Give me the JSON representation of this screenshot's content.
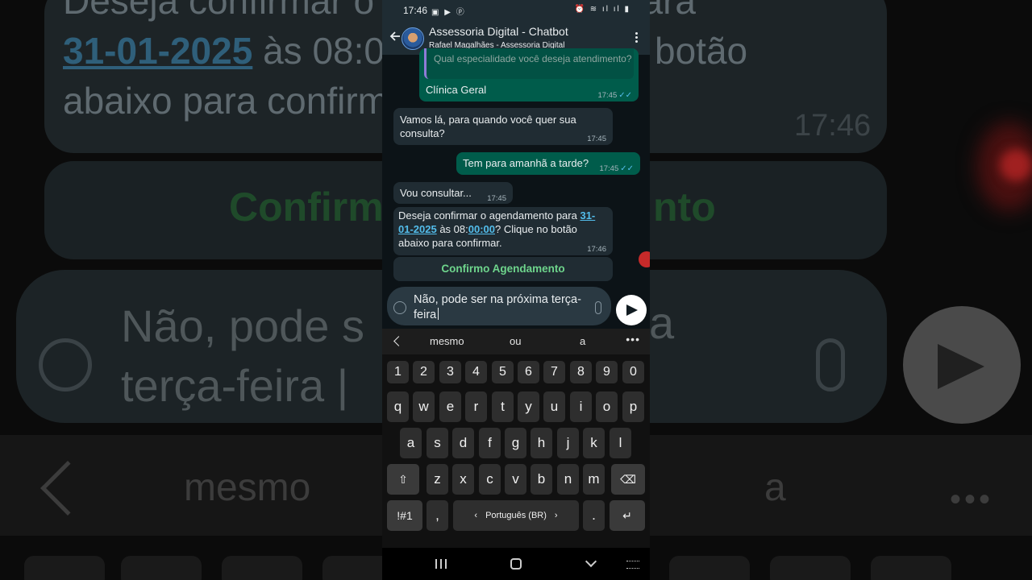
{
  "background": {
    "top_text_line1": "Deseja confirmar o agendamento para",
    "top_text_date": "31-01-2025",
    "top_text_line2_rest": " às 08:00:00? Clique no botão",
    "top_text_line3": "abaixo para confirmar.",
    "top_time": "17:46",
    "button_left": "Confirm",
    "button_right": "nto",
    "input_line1": "Não, pode s",
    "input_line1_right": "a",
    "input_line2": "terça-feira |",
    "kb_word_1": "mesmo",
    "kb_word_2": "a",
    "kb_dots": "•••"
  },
  "status_bar": {
    "time": "17:46",
    "left_icons": "▣ ▶ ⓟ",
    "right_icons": "⏰ ≋ ıl ıl ▮"
  },
  "header": {
    "title": "Assessoria Digital - Chatbot",
    "subtitle": "Rafael Magalhães - Assessoria Digital"
  },
  "messages": {
    "m1": {
      "quote": "Qual especialidade você deseja atendimento?",
      "text": "Clínica Geral",
      "time": "17:45",
      "ticks": "✓✓"
    },
    "m2": {
      "text": "Vamos lá, para quando você quer sua consulta?",
      "time": "17:45"
    },
    "m3": {
      "text": "Tem para amanhã a tarde?",
      "time": "17:45",
      "ticks": "✓✓"
    },
    "m4": {
      "text": "Vou consultar...",
      "time": "17:45"
    },
    "m5": {
      "pre": "Deseja confirmar o agendamento para ",
      "date": "31-01-2025",
      "mid": " às 08:",
      "time_link": "00:00",
      "post": "? Clique no botão abaixo para confirmar.",
      "time": "17:46"
    },
    "confirm_button": "Confirmo Agendamento"
  },
  "composer": {
    "text": "Não, pode ser na próxima terça-feira"
  },
  "keyboard": {
    "suggestions": [
      "mesmo",
      "ou",
      "a"
    ],
    "more": "•••",
    "row_num": [
      "1",
      "2",
      "3",
      "4",
      "5",
      "6",
      "7",
      "8",
      "9",
      "0"
    ],
    "row_1": [
      "q",
      "w",
      "e",
      "r",
      "t",
      "y",
      "u",
      "i",
      "o",
      "p"
    ],
    "row_2": [
      "a",
      "s",
      "d",
      "f",
      "g",
      "h",
      "j",
      "k",
      "l"
    ],
    "row_3": [
      "z",
      "x",
      "c",
      "v",
      "b",
      "n",
      "m"
    ],
    "shift": "⇧",
    "backspace": "⌫",
    "symbols": "!#1",
    "comma": ",",
    "space_label": "Português (BR)",
    "space_left": "‹",
    "space_right": "›",
    "period": ".",
    "enter": "↵"
  }
}
